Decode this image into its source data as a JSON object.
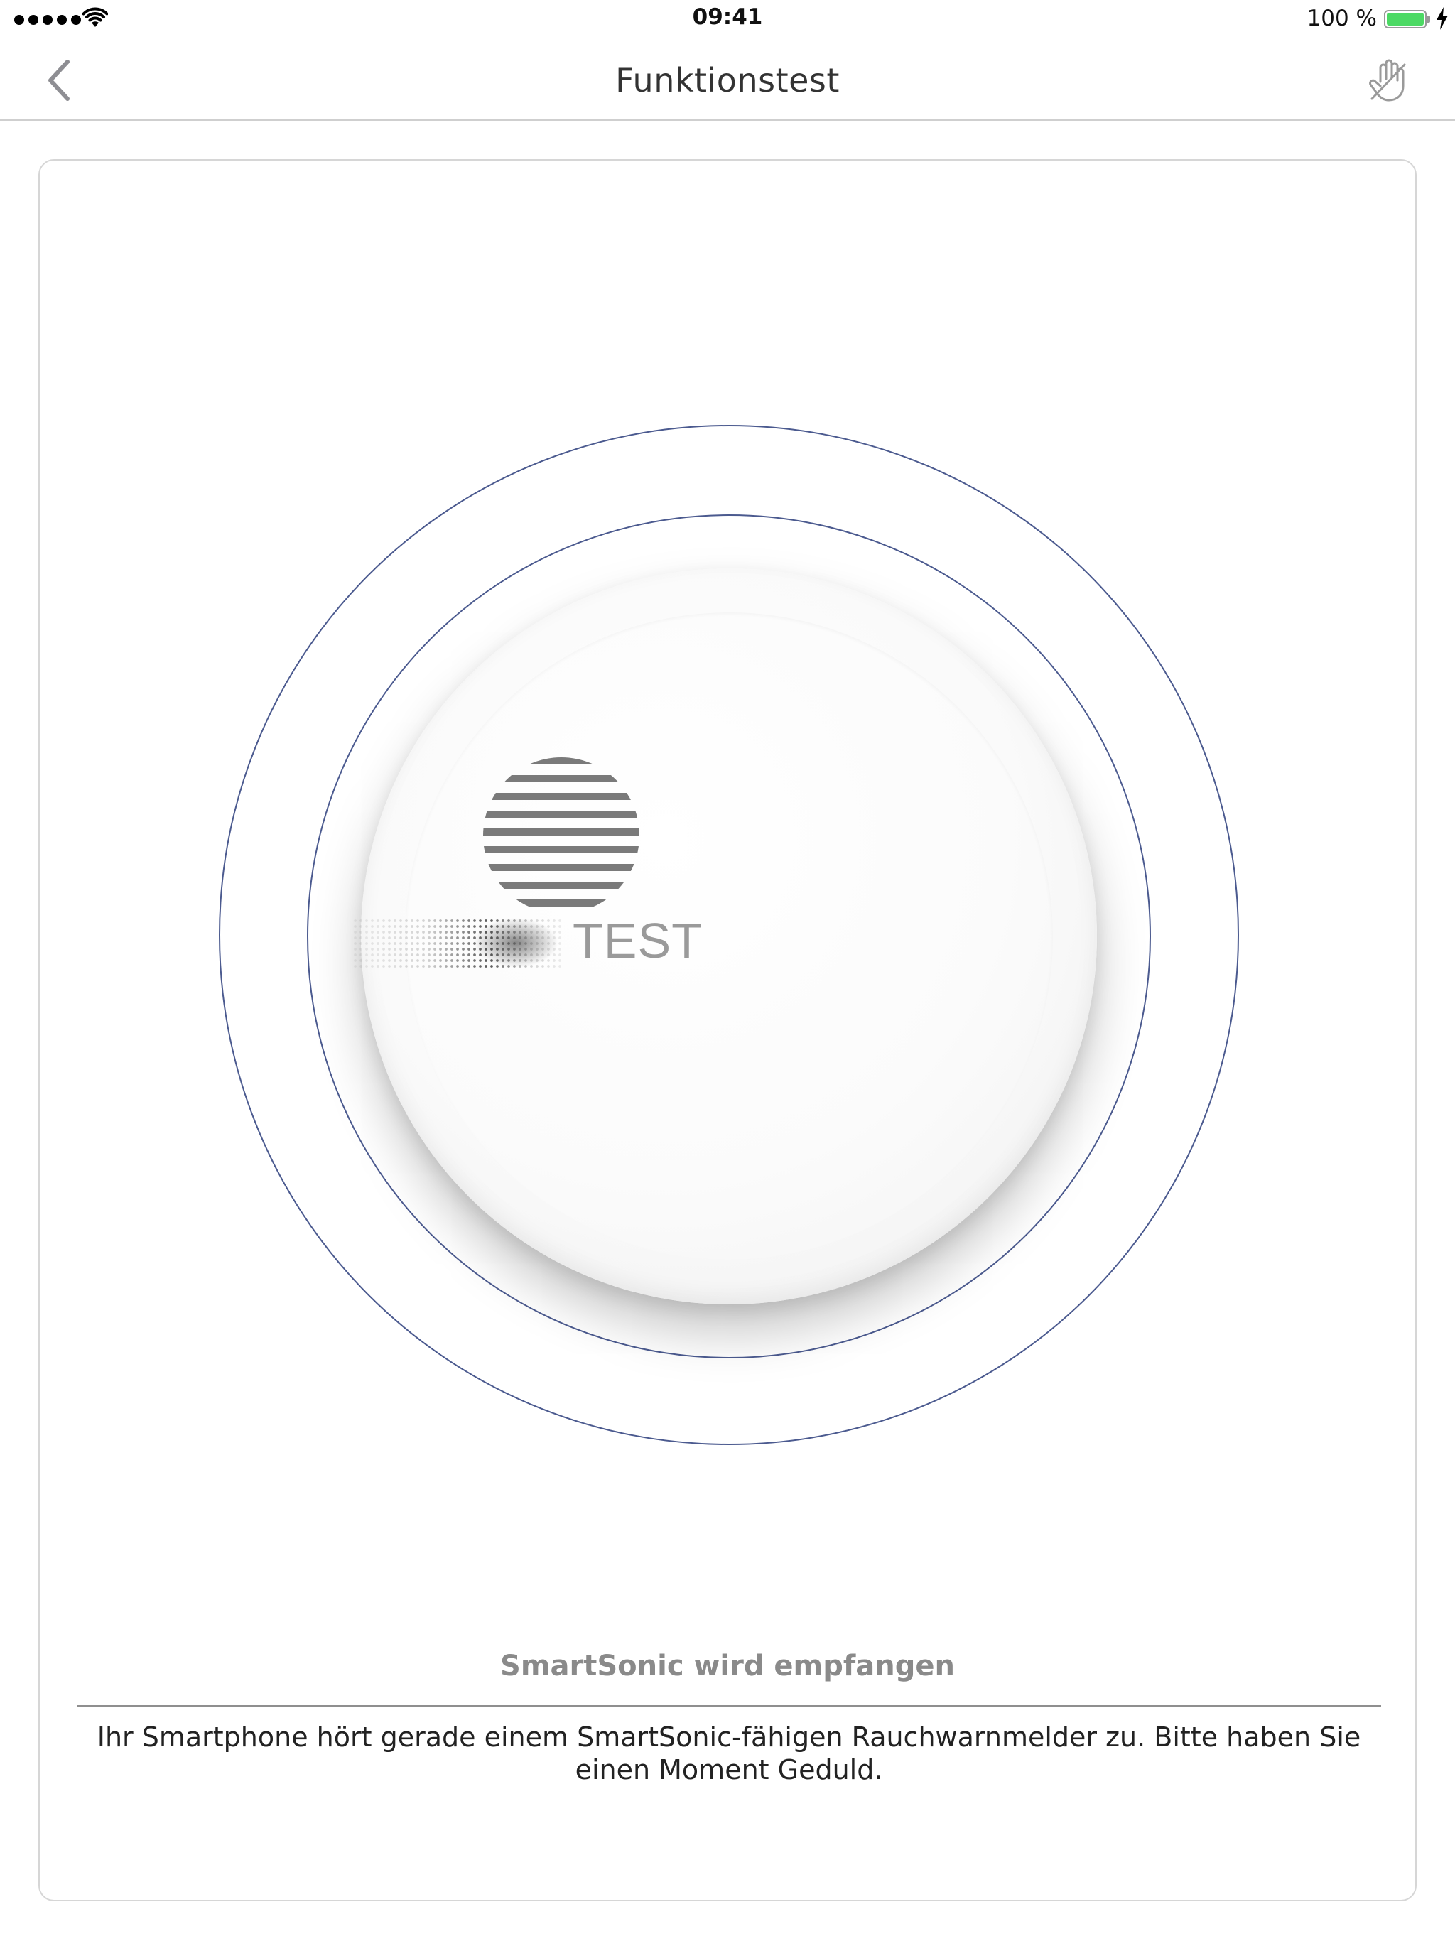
{
  "status_bar": {
    "time": "09:41",
    "battery_percent": "100 %",
    "battery_level": 1.0,
    "signal_bars": 5,
    "battery_color": "#4cd964"
  },
  "nav": {
    "title": "Funktionstest",
    "back_icon": "chevron-left-icon",
    "right_icon": "hand-icon"
  },
  "detector": {
    "button_label": "TEST",
    "ring_color": "#4b5a8f"
  },
  "status": {
    "title": "SmartSonic wird empfangen",
    "description": "Ihr Smartphone hört gerade einem SmartSonic-fähigen Rauchwarnmelder zu. Bitte haben Sie einen Moment Geduld."
  }
}
